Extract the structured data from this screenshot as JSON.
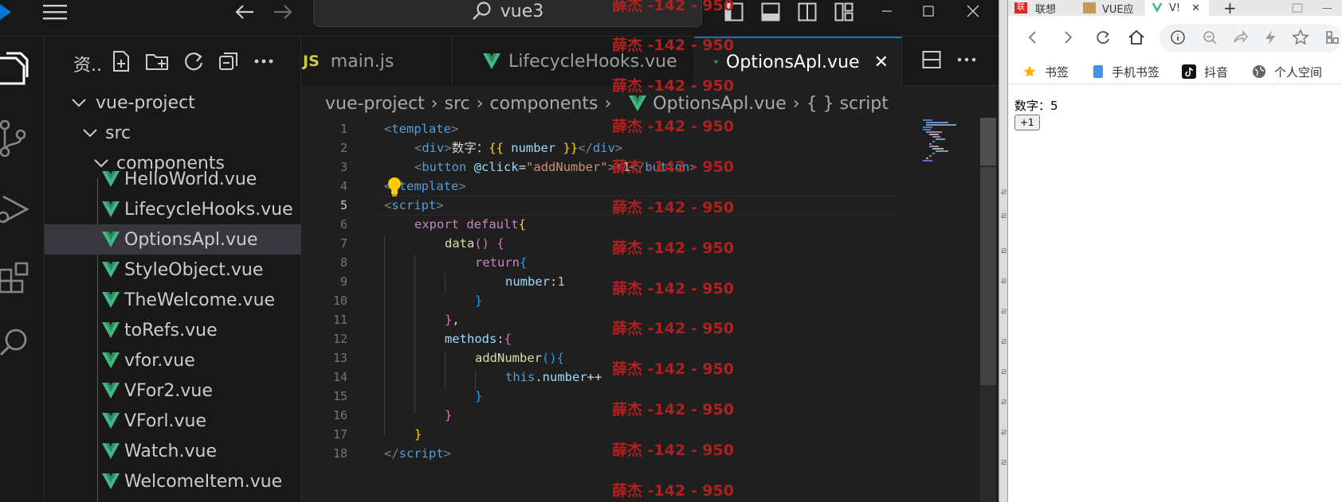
{
  "vscode": {
    "search_text": "vue3",
    "explorer_title": "资..",
    "tree": [
      {
        "label": "vue-project",
        "type": "folder"
      },
      {
        "label": "src",
        "type": "folder"
      },
      {
        "label": "components",
        "type": "folder"
      },
      {
        "label": "HelloWorld.vue",
        "type": "vue"
      },
      {
        "label": "LifecycleHooks.vue",
        "type": "vue"
      },
      {
        "label": "OptionsApl.vue",
        "type": "vue",
        "selected": true
      },
      {
        "label": "StyleObject.vue",
        "type": "vue"
      },
      {
        "label": "TheWelcome.vue",
        "type": "vue"
      },
      {
        "label": "toRefs.vue",
        "type": "vue"
      },
      {
        "label": "vfor.vue",
        "type": "vue"
      },
      {
        "label": "VFor2.vue",
        "type": "vue"
      },
      {
        "label": "VForl.vue",
        "type": "vue"
      },
      {
        "label": "Watch.vue",
        "type": "vue"
      },
      {
        "label": "WelcomeItem.vue",
        "type": "vue"
      }
    ],
    "tabs": [
      {
        "badge": "JS",
        "label": "main.js"
      },
      {
        "label": "LifecycleHooks.vue"
      },
      {
        "label": "OptionsApl.vue",
        "active": true
      }
    ],
    "breadcrumb": [
      "vue-project",
      "src",
      "components",
      "OptionsApl.vue",
      "{ } script"
    ],
    "line_numbers": [
      "1",
      "2",
      "3",
      "4",
      "5",
      "6",
      "7",
      "8",
      "9",
      "10",
      "11",
      "12",
      "13",
      "14",
      "15",
      "16",
      "17",
      "18"
    ],
    "current_line": 5,
    "code": {
      "l1_tag": "template",
      "l2_div": "div",
      "l2_text": "数字：",
      "l2_var": "number",
      "l3_tag": "button",
      "l3_attr": "@click",
      "l3_val": "\"addNumber\"",
      "l3_text": "+1",
      "l4_tag": "template",
      "l5_tag": "script",
      "l6_kw": "export default",
      "l7_fn": "data",
      "l8_kw": "return",
      "l9_key": "number",
      "l9_val": "1",
      "l12_key": "methods",
      "l13_fn": "addNumber",
      "l14_this": "this",
      "l14_prop": "number",
      "l14_op": "++",
      "l18_tag": "script"
    },
    "colors": {
      "accent": "#0078d4",
      "vue_green": "#41b883"
    }
  },
  "browser": {
    "tabs": [
      "联想",
      "VUE应",
      "V!"
    ],
    "bookmarks": [
      "书签",
      "手机书签",
      "抖音",
      "个人空间"
    ],
    "page_text": "数字：5",
    "page_button": "+1"
  },
  "watermark": {
    "text": "薛杰 -142 - 950"
  }
}
